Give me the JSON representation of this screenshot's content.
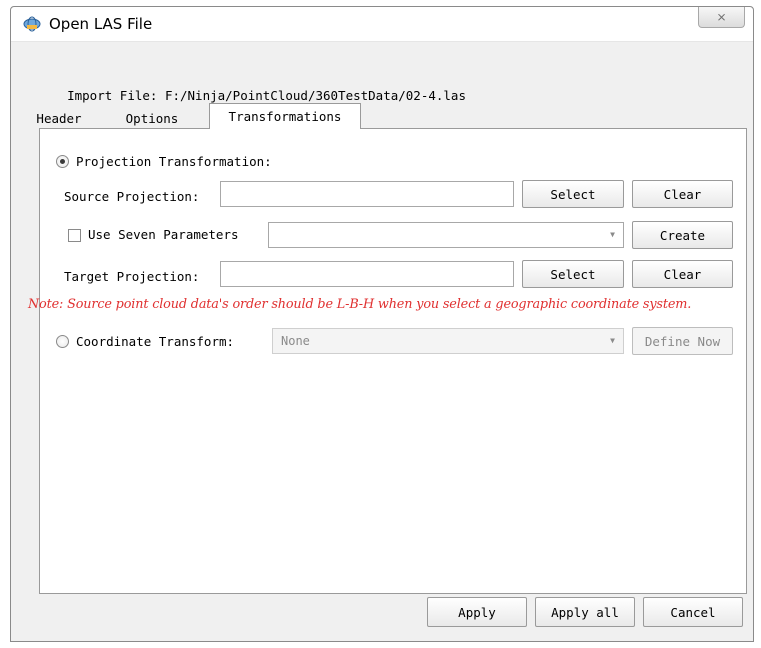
{
  "window": {
    "title": "Open LAS File",
    "close_glyph": "⨯"
  },
  "import": {
    "label": "Import File:",
    "path": "F:/Ninja/PointCloud/360TestData/02-4.las"
  },
  "tabs": [
    {
      "label": "Header",
      "active": false
    },
    {
      "label": "Options",
      "active": false
    },
    {
      "label": "Transformations",
      "active": true
    }
  ],
  "projection": {
    "radio_label": "Projection Transformation:",
    "selected": true,
    "source_label": "Source Projection:",
    "source_value": "",
    "select_label": "Select",
    "clear_label": "Clear",
    "seven_params_label": "Use Seven Parameters",
    "seven_params_checked": false,
    "seven_params_value": "",
    "create_label": "Create",
    "target_label": "Target Projection:",
    "target_value": ""
  },
  "note": "Note: Source point cloud data's order should be L-B-H when you select a geographic coordinate system.",
  "coordinate": {
    "radio_label": "Coordinate Transform:",
    "selected": false,
    "combo_value": "None",
    "define_label": "Define Now"
  },
  "footer": {
    "apply_label": "Apply",
    "apply_all_label": "Apply all",
    "cancel_label": "Cancel"
  },
  "colors": {
    "note": "#e03030",
    "panel_bg": "#ffffff",
    "window_bg": "#f0f0f0"
  }
}
